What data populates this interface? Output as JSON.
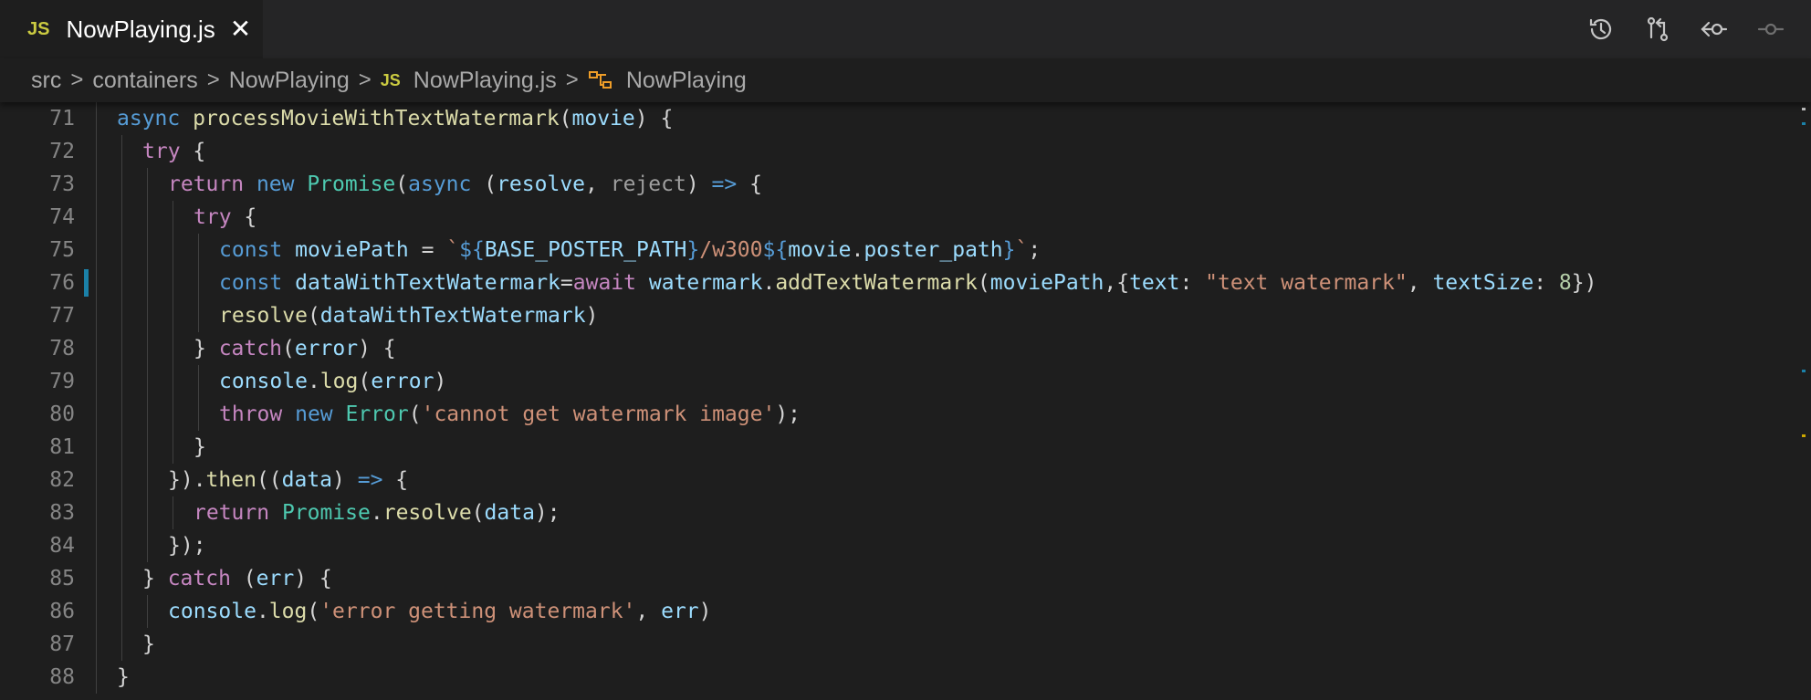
{
  "tab": {
    "lang_badge": "JS",
    "title": "NowPlaying.js",
    "close": "✕"
  },
  "toolbar": {
    "icons": [
      "history-icon",
      "compare-changes-icon",
      "open-changes-icon",
      "commit-icon"
    ]
  },
  "breadcrumb": {
    "items": [
      "src",
      "containers",
      "NowPlaying"
    ],
    "file_badge": "JS",
    "file": "NowPlaying.js",
    "symbol": "NowPlaying",
    "separator": ">"
  },
  "colors": {
    "background": "#1e1e1e",
    "keyword": "#569cd6",
    "control": "#c586c0",
    "function": "#dcdcaa",
    "variable": "#9cdcfe",
    "type": "#4ec9b0",
    "string": "#ce9178",
    "number": "#b5cea8",
    "modified_gutter": "#1b81a8"
  },
  "editor": {
    "lines": [
      {
        "num": "71",
        "indent": 1,
        "tokens": [
          [
            "k",
            "async "
          ],
          [
            "f",
            "processMovieWithTextWatermark"
          ],
          [
            "p",
            "("
          ],
          [
            "v",
            "movie"
          ],
          [
            "p",
            ") {"
          ]
        ]
      },
      {
        "num": "72",
        "indent": 2,
        "tokens": [
          [
            "c",
            "try"
          ],
          [
            "p",
            " {"
          ]
        ]
      },
      {
        "num": "73",
        "indent": 3,
        "tokens": [
          [
            "c",
            "return "
          ],
          [
            "k",
            "new "
          ],
          [
            "t",
            "Promise"
          ],
          [
            "p",
            "("
          ],
          [
            "k",
            "async "
          ],
          [
            "p",
            "("
          ],
          [
            "v",
            "resolve"
          ],
          [
            "p",
            ", "
          ],
          [
            "u",
            "reject"
          ],
          [
            "p",
            ") "
          ],
          [
            "k",
            "=>"
          ],
          [
            "p",
            " {"
          ]
        ]
      },
      {
        "num": "74",
        "indent": 4,
        "tokens": [
          [
            "c",
            "try"
          ],
          [
            "p",
            " {"
          ]
        ]
      },
      {
        "num": "75",
        "indent": 5,
        "tokens": [
          [
            "k",
            "const "
          ],
          [
            "v",
            "moviePath"
          ],
          [
            "p",
            " = "
          ],
          [
            "s",
            "`"
          ],
          [
            "k",
            "${"
          ],
          [
            "v",
            "BASE_POSTER_PATH"
          ],
          [
            "k",
            "}"
          ],
          [
            "s",
            "/w300"
          ],
          [
            "k",
            "${"
          ],
          [
            "v",
            "movie"
          ],
          [
            "p",
            "."
          ],
          [
            "v",
            "poster_path"
          ],
          [
            "k",
            "}"
          ],
          [
            "s",
            "`"
          ],
          [
            "p",
            ";"
          ]
        ]
      },
      {
        "num": "76",
        "indent": 5,
        "modified": true,
        "tokens": [
          [
            "k",
            "const "
          ],
          [
            "v",
            "dataWithTextWatermark"
          ],
          [
            "p",
            "="
          ],
          [
            "c",
            "await "
          ],
          [
            "v",
            "watermark"
          ],
          [
            "p",
            "."
          ],
          [
            "f",
            "addTextWatermark"
          ],
          [
            "p",
            "("
          ],
          [
            "v",
            "moviePath"
          ],
          [
            "p",
            ",{"
          ],
          [
            "v",
            "text"
          ],
          [
            "p",
            ": "
          ],
          [
            "s",
            "\"text watermark\""
          ],
          [
            "p",
            ", "
          ],
          [
            "v",
            "textSize"
          ],
          [
            "p",
            ": "
          ],
          [
            "n",
            "8"
          ],
          [
            "p",
            "})"
          ]
        ]
      },
      {
        "num": "77",
        "indent": 5,
        "tokens": [
          [
            "f",
            "resolve"
          ],
          [
            "p",
            "("
          ],
          [
            "v",
            "dataWithTextWatermark"
          ],
          [
            "p",
            ")"
          ]
        ]
      },
      {
        "num": "78",
        "indent": 4,
        "tokens": [
          [
            "p",
            "} "
          ],
          [
            "c",
            "catch"
          ],
          [
            "p",
            "("
          ],
          [
            "v",
            "error"
          ],
          [
            "p",
            ") {"
          ]
        ]
      },
      {
        "num": "79",
        "indent": 5,
        "tokens": [
          [
            "v",
            "console"
          ],
          [
            "p",
            "."
          ],
          [
            "f",
            "log"
          ],
          [
            "p",
            "("
          ],
          [
            "v",
            "error"
          ],
          [
            "p",
            ")"
          ]
        ]
      },
      {
        "num": "80",
        "indent": 5,
        "tokens": [
          [
            "c",
            "throw "
          ],
          [
            "k",
            "new "
          ],
          [
            "t",
            "Error"
          ],
          [
            "p",
            "("
          ],
          [
            "s",
            "'cannot get watermark image'"
          ],
          [
            "p",
            ");"
          ]
        ]
      },
      {
        "num": "81",
        "indent": 4,
        "tokens": [
          [
            "p",
            "}"
          ]
        ]
      },
      {
        "num": "82",
        "indent": 3,
        "tokens": [
          [
            "p",
            "})."
          ],
          [
            "f",
            "then"
          ],
          [
            "p",
            "(("
          ],
          [
            "v",
            "data"
          ],
          [
            "p",
            ") "
          ],
          [
            "k",
            "=>"
          ],
          [
            "p",
            " {"
          ]
        ]
      },
      {
        "num": "83",
        "indent": 4,
        "tokens": [
          [
            "c",
            "return "
          ],
          [
            "t",
            "Promise"
          ],
          [
            "p",
            "."
          ],
          [
            "f",
            "resolve"
          ],
          [
            "p",
            "("
          ],
          [
            "v",
            "data"
          ],
          [
            "p",
            ");"
          ]
        ]
      },
      {
        "num": "84",
        "indent": 3,
        "tokens": [
          [
            "p",
            "});"
          ]
        ]
      },
      {
        "num": "85",
        "indent": 2,
        "tokens": [
          [
            "p",
            "} "
          ],
          [
            "c",
            "catch"
          ],
          [
            "p",
            " ("
          ],
          [
            "v",
            "err"
          ],
          [
            "p",
            ") {"
          ]
        ]
      },
      {
        "num": "86",
        "indent": 3,
        "tokens": [
          [
            "v",
            "console"
          ],
          [
            "p",
            "."
          ],
          [
            "f",
            "log"
          ],
          [
            "p",
            "("
          ],
          [
            "s",
            "'error getting watermark'"
          ],
          [
            "p",
            ", "
          ],
          [
            "v",
            "err"
          ],
          [
            "p",
            ")"
          ]
        ]
      },
      {
        "num": "87",
        "indent": 2,
        "tokens": [
          [
            "p",
            "}"
          ]
        ]
      },
      {
        "num": "88",
        "indent": 1,
        "tokens": [
          [
            "p",
            "}"
          ]
        ]
      }
    ]
  }
}
